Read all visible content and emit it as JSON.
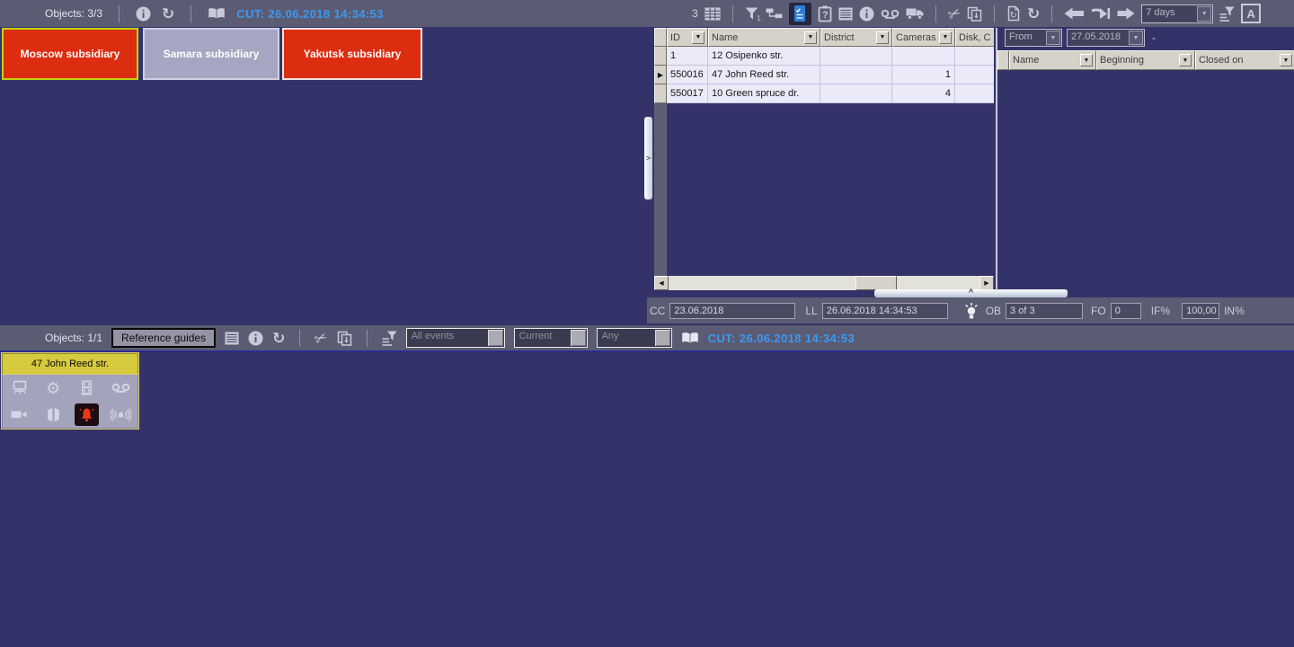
{
  "icons": {
    "dropdown_arrow": "▼",
    "row_indicator": "▶",
    "scroll_left": "◀",
    "scroll_right": "▶",
    "splitter_right": ">",
    "splitter_up": "^",
    "gear": "⚙",
    "scissors": "✂",
    "refresh": "↻",
    "funnel_badge": "1.",
    "letter_a": "A"
  },
  "top_left": {
    "objects_label": "Objects: 3/3",
    "cut_label": "CUT: 26.06.2018 14:34:53"
  },
  "subsidiaries": [
    {
      "label": "Moscow subsidiary"
    },
    {
      "label": "Samara subsidiary"
    },
    {
      "label": "Yakutsk subsidiary"
    }
  ],
  "top_right": {
    "count": "3",
    "period_value": "7 days"
  },
  "objects_table": {
    "columns": {
      "id": "ID",
      "name": "Name",
      "district": "District",
      "cameras": "Cameras",
      "disk": "Disk, C"
    },
    "rows": [
      {
        "id": "1",
        "name": "12 Osipenko str.",
        "district": "",
        "cameras": ""
      },
      {
        "id": "550016",
        "name": "47 John Reed str.",
        "district": "",
        "cameras": "1"
      },
      {
        "id": "550017",
        "name": "10 Green spruce dr.",
        "district": "",
        "cameras": "4"
      }
    ]
  },
  "filter_panel": {
    "from_value": "From",
    "date_value": "27.05.2018",
    "dash": "-",
    "columns": {
      "name": "Name",
      "beginning": "Beginning",
      "closed": "Closed on"
    }
  },
  "status_bar": {
    "cc_label": "CC",
    "cc_value": "23.06.2018",
    "ll_label": "LL",
    "ll_value": "26.06.2018 14:34:53",
    "ob_label": "OB",
    "ob_value": "3 of 3",
    "fo_label": "FO",
    "fo_value": "0",
    "if_label": "IF%",
    "if_value": "100,00",
    "in_label": "IN%"
  },
  "bottom": {
    "objects_label": "Objects: 1/1",
    "reference_guides": "Reference guides",
    "events_value": "All events",
    "current_value": "Current",
    "any_value": "Any",
    "cut_label": "CUT: 26.06.2018 14:34:53",
    "object_title": "47 John Reed str."
  }
}
